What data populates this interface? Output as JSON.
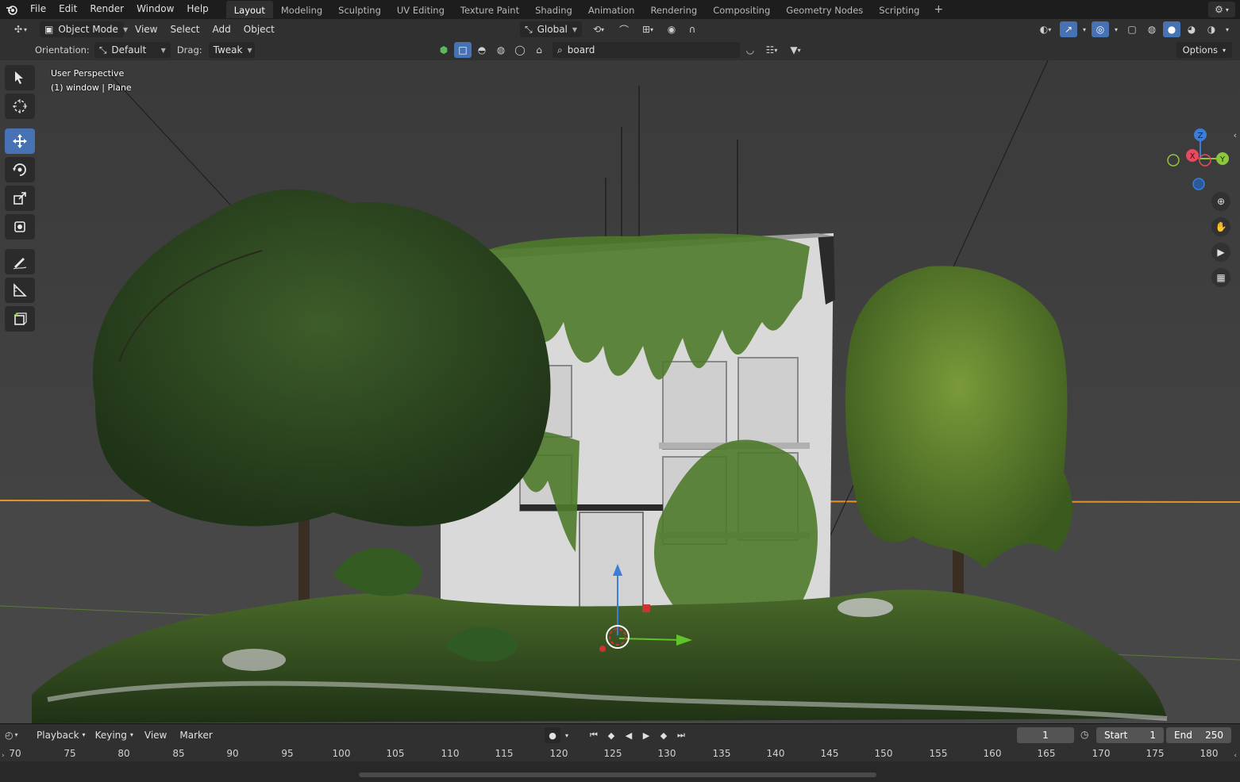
{
  "topbar": {
    "menus": [
      "File",
      "Edit",
      "Render",
      "Window",
      "Help"
    ],
    "workspaces": [
      "Layout",
      "Modeling",
      "Sculpting",
      "UV Editing",
      "Texture Paint",
      "Shading",
      "Animation",
      "Rendering",
      "Compositing",
      "Geometry Nodes",
      "Scripting"
    ],
    "active_workspace": "Layout",
    "add_label": "+"
  },
  "viewport_header": {
    "mode": "Object Mode",
    "menus": [
      "View",
      "Select",
      "Add",
      "Object"
    ],
    "orientation": "Global"
  },
  "tool_settings": {
    "orientation_label": "Orientation:",
    "orientation_value": "Default",
    "drag_label": "Drag:",
    "drag_value": "Tweak",
    "search_value": "board",
    "options_label": "Options"
  },
  "viewport": {
    "perspective": "User Perspective",
    "context": "(1) window | Plane"
  },
  "gizmo": {
    "z": "Z",
    "x": "X",
    "y": "Y",
    "colors": {
      "x": "#e84a5f",
      "y": "#8cc63f",
      "z": "#3b7dd8"
    }
  },
  "timeline": {
    "menus": {
      "playback": "Playback",
      "keying": "Keying",
      "view": "View",
      "marker": "Marker"
    },
    "current_frame": "1",
    "start_label": "Start",
    "start_value": "1",
    "end_label": "End",
    "end_value": "250",
    "ruler_ticks": [
      "70",
      "75",
      "80",
      "85",
      "90",
      "95",
      "100",
      "105",
      "110",
      "115",
      "120",
      "125",
      "130",
      "135",
      "140",
      "145",
      "150",
      "155",
      "160",
      "165",
      "170",
      "175",
      "180"
    ]
  },
  "colors": {
    "accent": "#4772b3",
    "horizon": "#e8902a"
  }
}
